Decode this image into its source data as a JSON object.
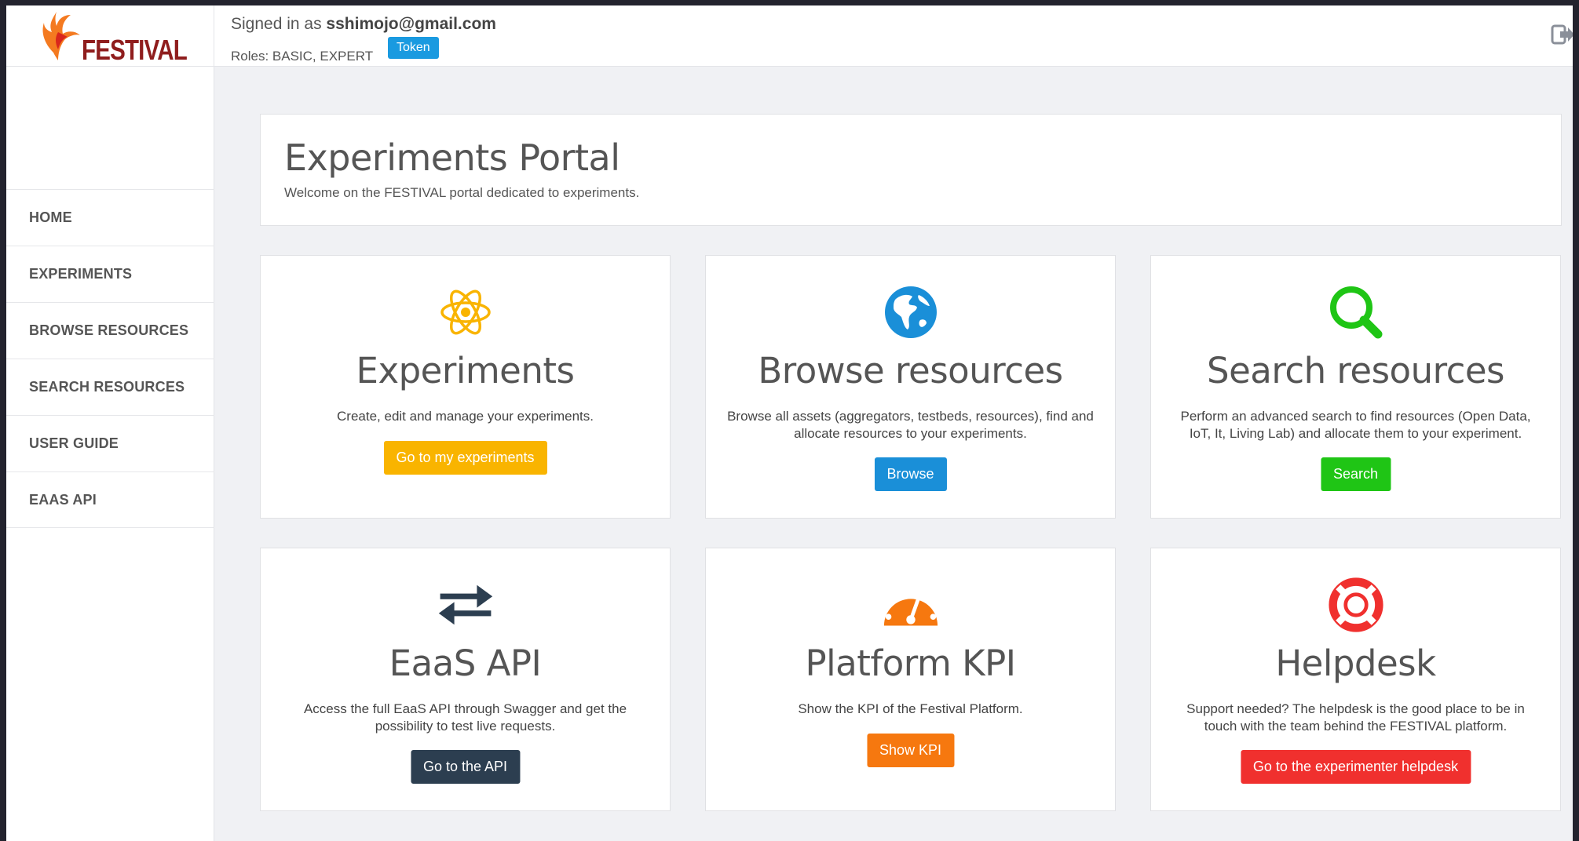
{
  "header": {
    "logo_text": "FESTIVAL",
    "signed_prefix": "Signed in as ",
    "user_email": "sshimojo@gmail.com",
    "roles": "Roles: BASIC, EXPERT",
    "token_label": "Token"
  },
  "sidebar": {
    "items": [
      {
        "label": "HOME"
      },
      {
        "label": "EXPERIMENTS"
      },
      {
        "label": "BROWSE RESOURCES"
      },
      {
        "label": "SEARCH RESOURCES"
      },
      {
        "label": "USER GUIDE"
      },
      {
        "label": "EAAS API"
      }
    ]
  },
  "main": {
    "title": "Experiments Portal",
    "subtitle": "Welcome on the FESTIVAL portal dedicated to experiments.",
    "cards": [
      {
        "icon": "atom-icon",
        "title": "Experiments",
        "description": "Create, edit and manage your experiments.",
        "button": "Go to my experiments",
        "color": "#f9b400"
      },
      {
        "icon": "globe-icon",
        "title": "Browse resources",
        "description": "Browse all assets (aggregators, testbeds, resources), find and allocate resources to your experiments.",
        "button": "Browse",
        "color": "#1a8fd8"
      },
      {
        "icon": "search-icon",
        "title": "Search resources",
        "description": "Perform an advanced search to find resources (Open Data, IoT, It, Living Lab) and allocate them to your experiment.",
        "button": "Search",
        "color": "#1fc515"
      },
      {
        "icon": "exchange-arrows-icon",
        "title": "EaaS API",
        "description": "Access the full EaaS API through Swagger and get the possibility to test live requests.",
        "button": "Go to the API",
        "color": "#2c3e50"
      },
      {
        "icon": "dashboard-gauge-icon",
        "title": "Platform KPI",
        "description": "Show the KPI of the Festival Platform.",
        "button": "Show KPI",
        "color": "#f6780f"
      },
      {
        "icon": "lifebuoy-icon",
        "title": "Helpdesk",
        "description": "Support needed? The helpdesk is the good place to be in touch with the team behind the FESTIVAL platform.",
        "button": "Go to the experimenter helpdesk",
        "color": "#f0302e"
      }
    ]
  }
}
